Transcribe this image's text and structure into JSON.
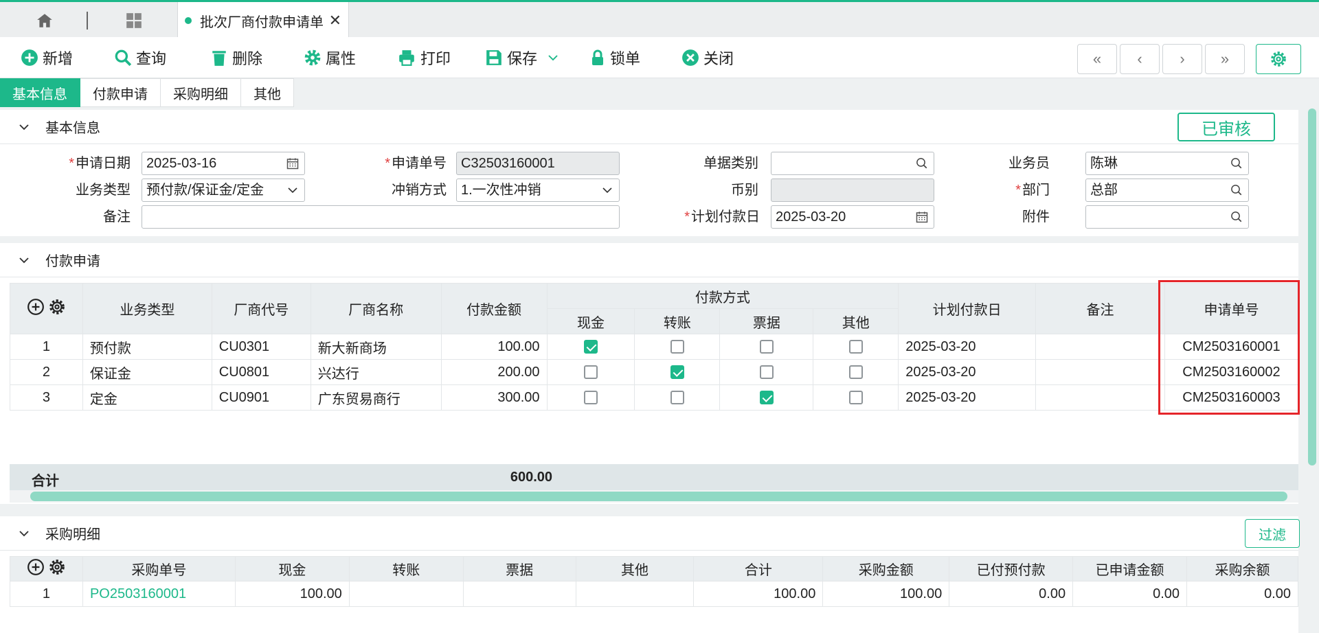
{
  "tab": {
    "title": "批次厂商付款申请单",
    "close": "✕"
  },
  "toolbar": {
    "add": "新增",
    "query": "查询",
    "delete": "删除",
    "props": "属性",
    "print": "打印",
    "save": "保存",
    "lock": "锁单",
    "close": "关闭"
  },
  "nav": {
    "first": "«",
    "prev": "‹",
    "next": "›",
    "last": "»"
  },
  "section_tabs": [
    "基本信息",
    "付款申请",
    "采购明细",
    "其他"
  ],
  "basic": {
    "title": "基本信息",
    "status": "已审核",
    "apply_date_label": "申请日期",
    "apply_date": "2025-03-16",
    "apply_no_label": "申请单号",
    "apply_no": "C32503160001",
    "doc_type_label": "单据类别",
    "doc_type": "",
    "staff_label": "业务员",
    "staff": "陈琳",
    "biz_type_label": "业务类型",
    "biz_type": "预付款/保证金/定金",
    "writeoff_label": "冲销方式",
    "writeoff": "1.一次性冲销",
    "currency_label": "币别",
    "currency": "",
    "dept_label": "部门",
    "dept": "总部",
    "remark_label": "备注",
    "remark": "",
    "plan_date_label": "计划付款日",
    "plan_date": "2025-03-20",
    "attach_label": "附件",
    "attach": "",
    "required_mark": "*"
  },
  "payment": {
    "title": "付款申请",
    "headers": {
      "biz_type": "业务类型",
      "vendor_code": "厂商代号",
      "vendor_name": "厂商名称",
      "amount": "付款金额",
      "method": "付款方式",
      "cash": "现金",
      "transfer": "转账",
      "bill": "票据",
      "other": "其他",
      "plan_date": "计划付款日",
      "remark": "备注",
      "apply_no": "申请单号"
    },
    "rows": [
      {
        "no": "1",
        "biz_type": "预付款",
        "vendor_code": "CU0301",
        "vendor_name": "新大新商场",
        "amount": "100.00",
        "cash": true,
        "transfer": false,
        "bill": false,
        "other": false,
        "plan_date": "2025-03-20",
        "remark": "",
        "apply_no": "CM2503160001"
      },
      {
        "no": "2",
        "biz_type": "保证金",
        "vendor_code": "CU0801",
        "vendor_name": "兴达行",
        "amount": "200.00",
        "cash": false,
        "transfer": true,
        "bill": false,
        "other": false,
        "plan_date": "2025-03-20",
        "remark": "",
        "apply_no": "CM2503160002"
      },
      {
        "no": "3",
        "biz_type": "定金",
        "vendor_code": "CU0901",
        "vendor_name": "广东贸易商行",
        "amount": "300.00",
        "cash": false,
        "transfer": false,
        "bill": true,
        "other": false,
        "plan_date": "2025-03-20",
        "remark": "",
        "apply_no": "CM2503160003"
      }
    ],
    "total_label": "合计",
    "total_amount": "600.00"
  },
  "purchase": {
    "title": "采购明细",
    "filter": "过滤",
    "headers": {
      "po_no": "采购单号",
      "cash": "现金",
      "transfer": "转账",
      "bill": "票据",
      "other": "其他",
      "sum": "合计",
      "po_amount": "采购金额",
      "prepaid": "已付预付款",
      "applied": "已申请金额",
      "balance": "采购余额"
    },
    "rows": [
      {
        "no": "1",
        "po_no": "PO2503160001",
        "cash": "100.00",
        "transfer": "",
        "bill": "",
        "other": "",
        "sum": "100.00",
        "po_amount": "100.00",
        "prepaid": "0.00",
        "applied": "0.00",
        "balance": "0.00"
      }
    ]
  },
  "colors": {
    "accent": "#1db88a",
    "highlight": "#e5252a"
  }
}
